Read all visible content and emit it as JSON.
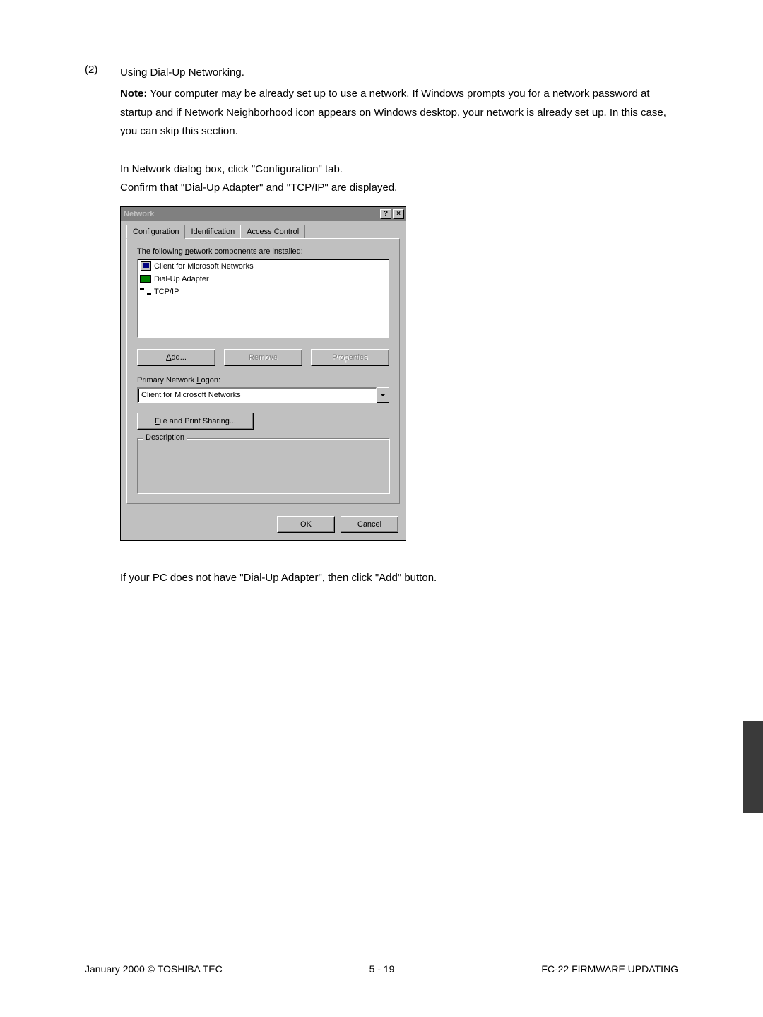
{
  "section": {
    "number": "(2)",
    "title": "Using Dial-Up Networking.",
    "note_label": "Note:",
    "note_text": " Your computer may be already set up to use a network. If Windows prompts you for a network password at startup and if Network Neighborhood icon appears on  Windows desktop, your network is already set up. In this case, you can skip this section.",
    "para2_line1": "In Network dialog box, click \"Configuration\" tab.",
    "para2_line2": "Confirm that \"Dial-Up Adapter\" and \"TCP/IP\" are displayed.",
    "after_dialog": "If your PC does not have \"Dial-Up Adapter\", then click \"Add\" button."
  },
  "dialog": {
    "title": "Network",
    "help_btn": "?",
    "close_btn": "×",
    "tabs": {
      "configuration": "Configuration",
      "identification": "Identification",
      "access_control": "Access Control"
    },
    "components_label_pre": "The following ",
    "components_label_u": "n",
    "components_label_post": "etwork components are installed:",
    "list": {
      "item1": "Client for Microsoft Networks",
      "item2": "Dial-Up Adapter",
      "item3": "TCP/IP"
    },
    "buttons": {
      "add_u": "A",
      "add_post": "dd...",
      "remove_u": "R",
      "remove_post": "emove",
      "properties": "Properties",
      "properties_u": "r"
    },
    "primary_label_pre": "Primary Network ",
    "primary_label_u": "L",
    "primary_label_post": "ogon:",
    "primary_value": "Client for Microsoft Networks",
    "file_share_u": "F",
    "file_share_post": "ile and Print Sharing...",
    "description_label": "Description",
    "ok": "OK",
    "cancel": "Cancel"
  },
  "footer": {
    "left": "January 2000  ©  TOSHIBA TEC",
    "center": "5 - 19",
    "right": "FC-22  FIRMWARE UPDATING"
  }
}
